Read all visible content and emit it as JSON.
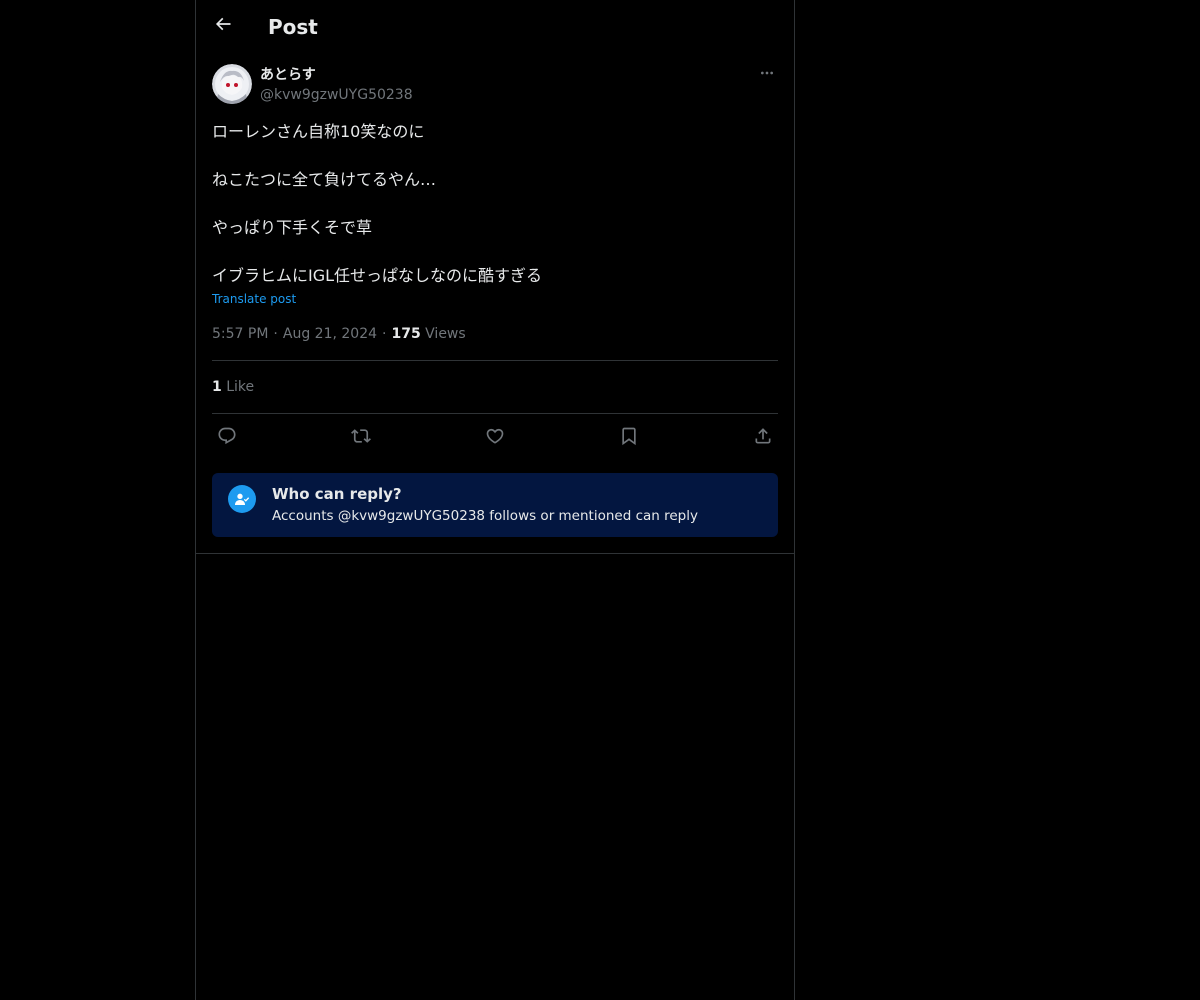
{
  "header": {
    "title": "Post",
    "back_icon": "arrow-left-icon"
  },
  "post": {
    "author": {
      "display_name": "あとらす",
      "handle": "@kvw9gzwUYG50238"
    },
    "more_icon": "more-horizontal-icon",
    "lines": [
      "ローレンさん自称10笑なのに",
      "ねこたつに全て負けてるやん…",
      "やっぱり下手くそで草",
      "イブラヒムにIGL任せっぱなしなのに酷すぎる"
    ],
    "translate_label": "Translate post",
    "time": "5:57 PM",
    "date": "Aug 21, 2024",
    "views_count": "175",
    "views_label": "Views",
    "likes_count": "1",
    "likes_label": "Like"
  },
  "actions": {
    "reply": "reply-icon",
    "repost": "repost-icon",
    "like": "heart-icon",
    "bookmark": "bookmark-icon",
    "share": "share-icon"
  },
  "reply_restriction": {
    "title": "Who can reply?",
    "text": "Accounts @kvw9gzwUYG50238 follows or mentioned can reply",
    "icon": "person-check-icon"
  },
  "colors": {
    "background": "#000000",
    "text_primary": "#e7e9ea",
    "text_secondary": "#71767b",
    "accent": "#1d9bf0",
    "reply_box_bg": "#031640",
    "border": "#2f3336"
  }
}
